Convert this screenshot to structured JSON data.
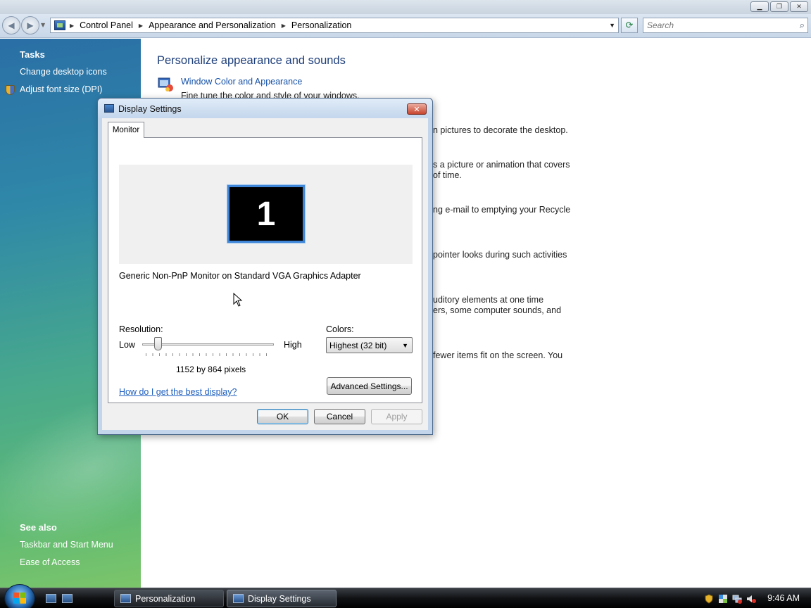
{
  "window": {
    "caption_buttons": [
      "minimize",
      "restore",
      "close"
    ]
  },
  "address_bar": {
    "breadcrumbs": [
      "Control Panel",
      "Appearance and Personalization",
      "Personalization"
    ],
    "search_placeholder": "Search"
  },
  "task_pane": {
    "tasks_heading": "Tasks",
    "tasks": [
      "Change desktop icons",
      "Adjust font size (DPI)"
    ],
    "see_also_heading": "See also",
    "see_also": [
      "Taskbar and Start Menu",
      "Ease of Access"
    ]
  },
  "main": {
    "title": "Personalize appearance and sounds",
    "first_item_link": "Window Color and Appearance",
    "first_item_desc": "Fine tune the color and style of your windows.",
    "visible_desc_fragments": [
      "n pictures to decorate the desktop.",
      "s a picture or animation that covers",
      " of time.",
      "ng e-mail to emptying your Recycle",
      " pointer looks during such activities",
      "uditory elements at one time",
      "ers, some computer sounds, and",
      "fewer items fit on the screen. You"
    ]
  },
  "dialog": {
    "title": "Display Settings",
    "tab": "Monitor",
    "monitor_number": "1",
    "monitor_name": "Generic Non-PnP Monitor on Standard VGA Graphics Adapter",
    "resolution_label": "Resolution:",
    "low_label": "Low",
    "high_label": "High",
    "resolution_value": "1152 by 864 pixels",
    "resolution_slider_fraction": 0.12,
    "colors_label": "Colors:",
    "colors_selected": "Highest (32 bit)",
    "help_link": "How do I get the best display?",
    "advanced_button": "Advanced Settings...",
    "ok_button": "OK",
    "cancel_button": "Cancel",
    "apply_button": "Apply"
  },
  "taskbar": {
    "buttons": [
      "Personalization",
      "Display Settings"
    ],
    "clock": "9:46 AM"
  },
  "colors": {
    "accent_link": "#1450a8",
    "title_blue": "#1e3f7a",
    "monitor_highlight": "#3f86d8"
  }
}
